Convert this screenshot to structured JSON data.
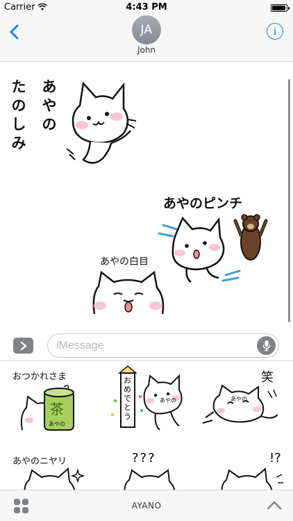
{
  "status_bar": {
    "carrier": "Carrier",
    "time": "4:43 PM",
    "battery_level": 0.95
  },
  "nav": {
    "avatar_initials": "JA",
    "contact_name": "John",
    "back_icon": "chevron-left-icon",
    "info_icon": "info-icon"
  },
  "chat": {
    "sticker_1": {
      "caption_line1": "あやの",
      "caption_line2": "たのしみ"
    },
    "sticker_2": {
      "caption": "あやのピンチ"
    },
    "sticker_3": {
      "caption": "あやの白目"
    }
  },
  "input": {
    "placeholder": "iMessage",
    "value": ""
  },
  "drawer": {
    "stickers": [
      {
        "caption": "おつかれさま",
        "label": "茶",
        "sub": "あやの"
      },
      {
        "caption": "おめでとう",
        "sub": "あやの"
      },
      {
        "caption": "笑",
        "sub": "あやの"
      },
      {
        "caption": "あやのニヤリ"
      },
      {
        "caption": "???"
      },
      {
        "caption": "!?"
      }
    ]
  },
  "bottom_bar": {
    "pack_name": "AYANO"
  },
  "colors": {
    "accent": "#1a82fb",
    "bar_bg": "#f7f7f7",
    "control_gray": "#7e8388",
    "blush": "#f7c6d3"
  }
}
